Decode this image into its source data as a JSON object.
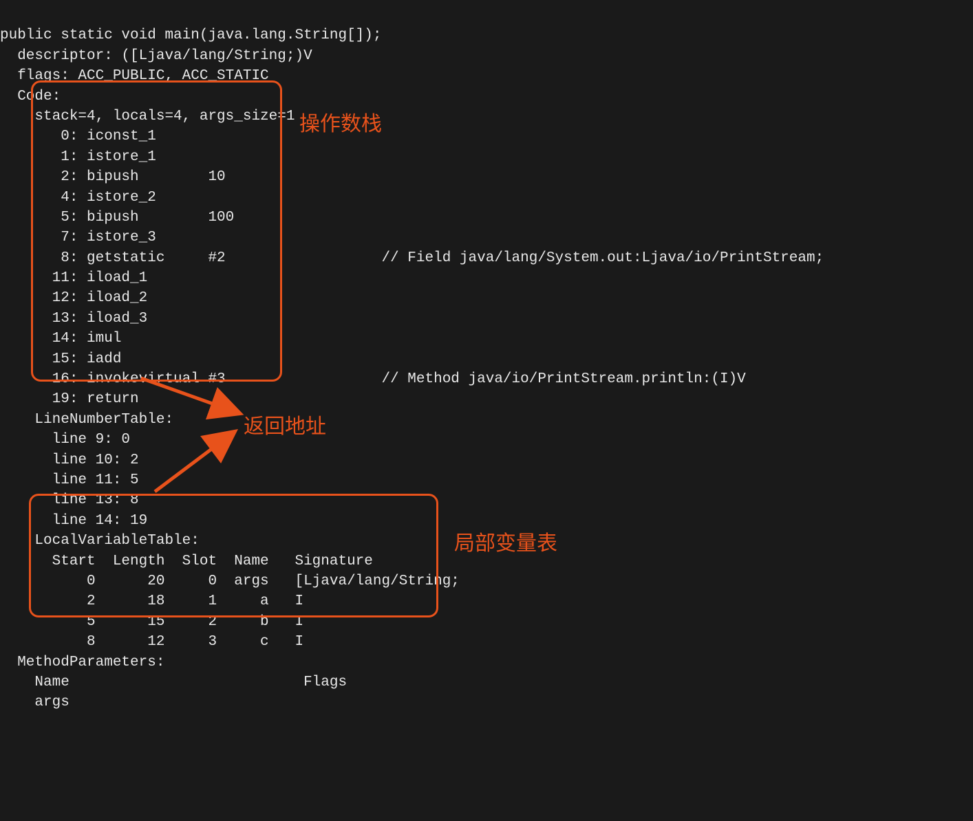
{
  "code": {
    "signature": "public static void main(java.lang.String[]);",
    "descriptor": "  descriptor: ([Ljava/lang/String;)V",
    "flags": "  flags: ACC_PUBLIC, ACC_STATIC",
    "code_label": "  Code:",
    "stack_line": "    stack=4, locals=4, args_size=1",
    "instructions": [
      "       0: iconst_1",
      "       1: istore_1",
      "       2: bipush        10",
      "       4: istore_2",
      "       5: bipush        100",
      "       7: istore_3",
      "       8: getstatic     #2                  // Field java/lang/System.out:Ljava/io/PrintStream;",
      "      11: iload_1",
      "      12: iload_2",
      "      13: iload_3",
      "      14: imul",
      "      15: iadd",
      "      16: invokevirtual #3                  // Method java/io/PrintStream.println:(I)V",
      "      19: return"
    ],
    "lnt_label": "    LineNumberTable:",
    "lnt_rows": [
      "      line 9: 0",
      "      line 10: 2",
      "      line 11: 5",
      "      line 13: 8",
      "      line 14: 19"
    ],
    "lvt_label": "    LocalVariableTable:",
    "lvt_header": "      Start  Length  Slot  Name   Signature",
    "lvt_rows": [
      "          0      20     0  args   [Ljava/lang/String;",
      "          2      18     1     a   I",
      "          5      15     2     b   I",
      "          8      12     3     c   I"
    ],
    "mp_label": "  MethodParameters:",
    "mp_header": "    Name                           Flags",
    "mp_row": "    args"
  },
  "annotations": {
    "operand_stack": "操作数栈",
    "return_address": "返回地址",
    "local_var_table": "局部变量表"
  },
  "chart_data": {
    "type": "table",
    "title": "LocalVariableTable",
    "columns": [
      "Start",
      "Length",
      "Slot",
      "Name",
      "Signature"
    ],
    "rows": [
      [
        0,
        20,
        0,
        "args",
        "[Ljava/lang/String;"
      ],
      [
        2,
        18,
        1,
        "a",
        "I"
      ],
      [
        5,
        15,
        2,
        "b",
        "I"
      ],
      [
        8,
        12,
        3,
        "c",
        "I"
      ]
    ]
  }
}
